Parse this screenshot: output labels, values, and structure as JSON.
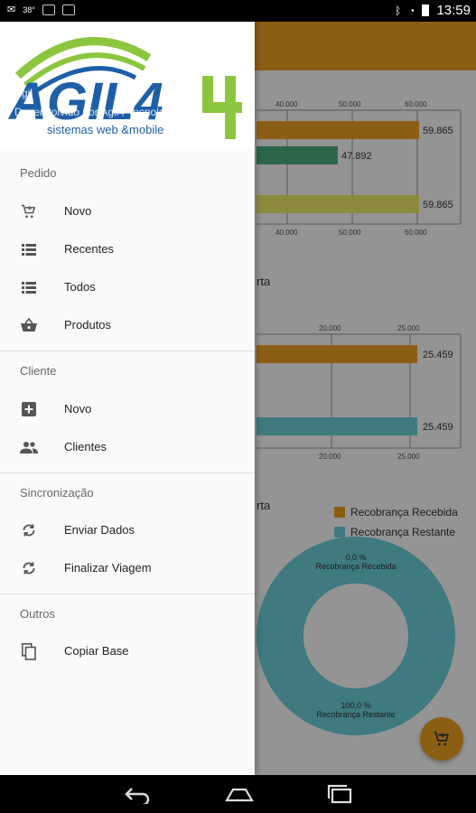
{
  "status_bar": {
    "left_text": "38°",
    "time": "13:59"
  },
  "drawer": {
    "header": {
      "line1": "Ágil",
      "line2": "Desenvolvido por Agil4 Tecnologia -",
      "logo_text": "AGIL4",
      "logo_tagline": "sistemas web &mobile"
    },
    "sections": [
      {
        "title": "Pedido",
        "items": [
          {
            "label": "Novo",
            "icon": "cart-add-icon"
          },
          {
            "label": "Recentes",
            "icon": "list-icon"
          },
          {
            "label": "Todos",
            "icon": "list-icon"
          },
          {
            "label": "Produtos",
            "icon": "basket-icon"
          }
        ]
      },
      {
        "title": "Cliente",
        "items": [
          {
            "label": "Novo",
            "icon": "plus-box-icon"
          },
          {
            "label": "Clientes",
            "icon": "people-icon"
          }
        ]
      },
      {
        "title": "Sincronização",
        "items": [
          {
            "label": "Enviar Dados",
            "icon": "sync-icon"
          },
          {
            "label": "Finalizar Viagem",
            "icon": "sync-icon"
          }
        ]
      },
      {
        "title": "Outros",
        "items": [
          {
            "label": "Copiar Base",
            "icon": "copy-icon"
          }
        ]
      }
    ]
  },
  "background": {
    "colors": {
      "toolbar": "#f2a324",
      "orange": "#f2a324",
      "green": "#4caf7d",
      "yellow": "#f5ee6a",
      "cyan": "#6cd3dd"
    },
    "chart1": {
      "top_ticks": [
        "40.000",
        "50.000",
        "60.000"
      ],
      "bottom_ticks": [
        "40.000",
        "50.000",
        "60.000"
      ],
      "values": [
        "59.865",
        "47.892",
        "59.865"
      ],
      "caption_fragment": "rta"
    },
    "chart2": {
      "top_ticks": [
        "20.000",
        "25.000"
      ],
      "bottom_ticks": [
        "20.000",
        "25.000"
      ],
      "values": [
        "25.459",
        "25.459"
      ],
      "caption_fragment": "rta"
    },
    "pie": {
      "legend": [
        "Recobrança Recebida",
        "Recobrança Restante"
      ],
      "label_top_pct": "0,0 %",
      "label_top_name": "Recobrança Recebida",
      "label_bottom_pct": "100,0 %",
      "label_bottom_name": "Recobrança Restante"
    }
  },
  "chart_data": [
    {
      "type": "bar",
      "values": [
        59865,
        47892,
        59865
      ]
    },
    {
      "type": "bar",
      "values": [
        25459,
        25459
      ]
    },
    {
      "type": "pie",
      "categories": [
        "Recobrança Recebida",
        "Recobrança Restante"
      ],
      "values": [
        0.0,
        100.0
      ]
    }
  ]
}
